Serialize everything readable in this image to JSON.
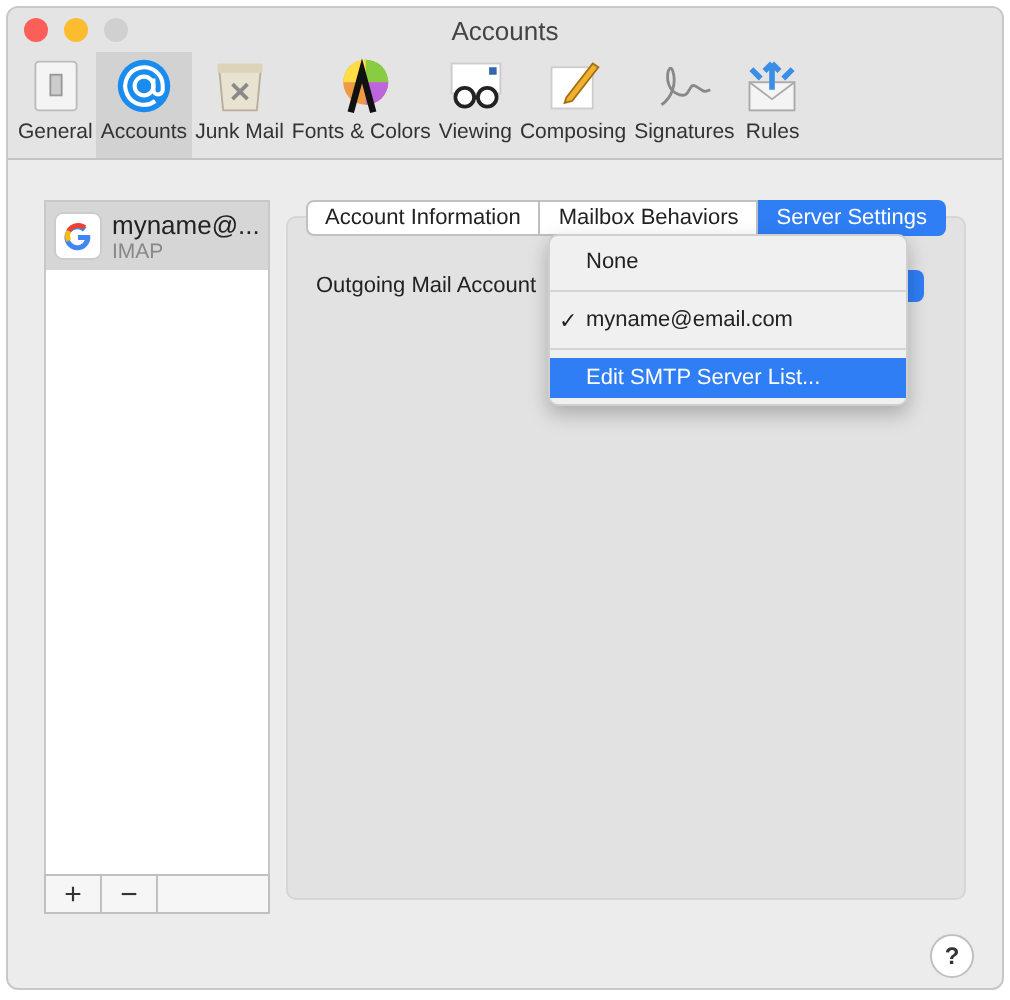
{
  "window": {
    "title": "Accounts"
  },
  "toolbar": [
    {
      "label": "General",
      "selected": false
    },
    {
      "label": "Accounts",
      "selected": true
    },
    {
      "label": "Junk Mail",
      "selected": false
    },
    {
      "label": "Fonts & Colors",
      "selected": false
    },
    {
      "label": "Viewing",
      "selected": false
    },
    {
      "label": "Composing",
      "selected": false
    },
    {
      "label": "Signatures",
      "selected": false
    },
    {
      "label": "Rules",
      "selected": false
    }
  ],
  "accounts": [
    {
      "name": "myname@...",
      "type": "IMAP",
      "selected": true
    }
  ],
  "account_buttons": [
    "+",
    "−"
  ],
  "tabs": [
    {
      "label": "Account Information",
      "selected": false
    },
    {
      "label": "Mailbox Behaviors",
      "selected": false
    },
    {
      "label": "Server Settings",
      "selected": true
    }
  ],
  "outgoing": {
    "label": "Outgoing Mail Account"
  },
  "menu": [
    {
      "label": "None",
      "checked": false,
      "highlighted": false
    },
    {
      "label": "myname@email.com",
      "checked": true,
      "highlighted": false
    },
    {
      "label": "Edit SMTP Server List...",
      "checked": false,
      "highlighted": true
    }
  ],
  "menu_check": "✓",
  "help": "?"
}
